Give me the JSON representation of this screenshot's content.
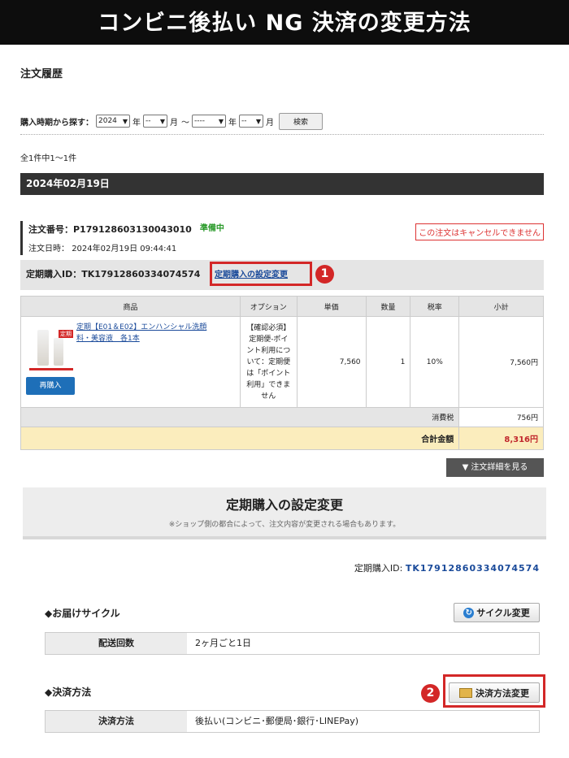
{
  "banner": "コンビニ後払い NG 決済の変更方法",
  "page_title": "注文履歴",
  "filter": {
    "label": "購入時期から探す：",
    "year_from": "2024",
    "year_unit": "年",
    "month_from": "--",
    "month_unit": "月",
    "tilde": "〜",
    "year_to": "----",
    "month_to": "--",
    "search_label": "検索"
  },
  "result_count": "全1件中1〜1件",
  "order": {
    "date_header": "2024年02月19日",
    "number_label": "注文番号：",
    "number": "P179128603130043010",
    "status": "準備中",
    "date_label": "注文日時：",
    "date": "2024年02月19日 09:44:41",
    "cancel_notice": "この注文はキャンセルできません",
    "subscription_label": "定期購入ID：",
    "subscription_id": "TK17912860334074574",
    "subscription_link": "定期購入の設定変更",
    "badge1": "1"
  },
  "table": {
    "headers": [
      "商品",
      "オプション",
      "単価",
      "数量",
      "税率",
      "小計"
    ],
    "product": {
      "tag": "定期",
      "name": "定期【E01＆E02】エンハンシャル洗顔料・美容液　各1本",
      "option": "【確認必須】定期便-ポイント利用について：定期便は「ポイント利用」できません",
      "price": "7,560",
      "qty": "1",
      "tax_rate": "10%",
      "subtotal": "7,560円",
      "rebuy": "再購入"
    },
    "tax_label": "消費税",
    "tax_value": "756円",
    "total_label": "合計金額",
    "total_value": "8,316円"
  },
  "detail_button": "▼ 注文詳細を見る",
  "subscription_section": {
    "title": "定期購入の設定変更",
    "note": "※ショップ側の都合によって、注文内容が変更される場合もあります。",
    "id_label": "定期購入ID:",
    "id_value": "TK17912860334074574",
    "cycle_heading": "◆お届けサイクル",
    "cycle_button": "サイクル変更",
    "cycle_key": "配送回数",
    "cycle_value": "2ヶ月ごと1日",
    "payment_heading": "◆決済方法",
    "payment_button": "決済方法変更",
    "payment_key": "決済方法",
    "payment_value": "後払い(コンビニ･郵便局･銀行･LINEPay)",
    "badge2": "2"
  },
  "colors": {
    "accent_red": "#d32727",
    "link_blue": "#1a4a9a",
    "total_bg": "#fbedbd",
    "status_green": "#2a9a2a"
  }
}
